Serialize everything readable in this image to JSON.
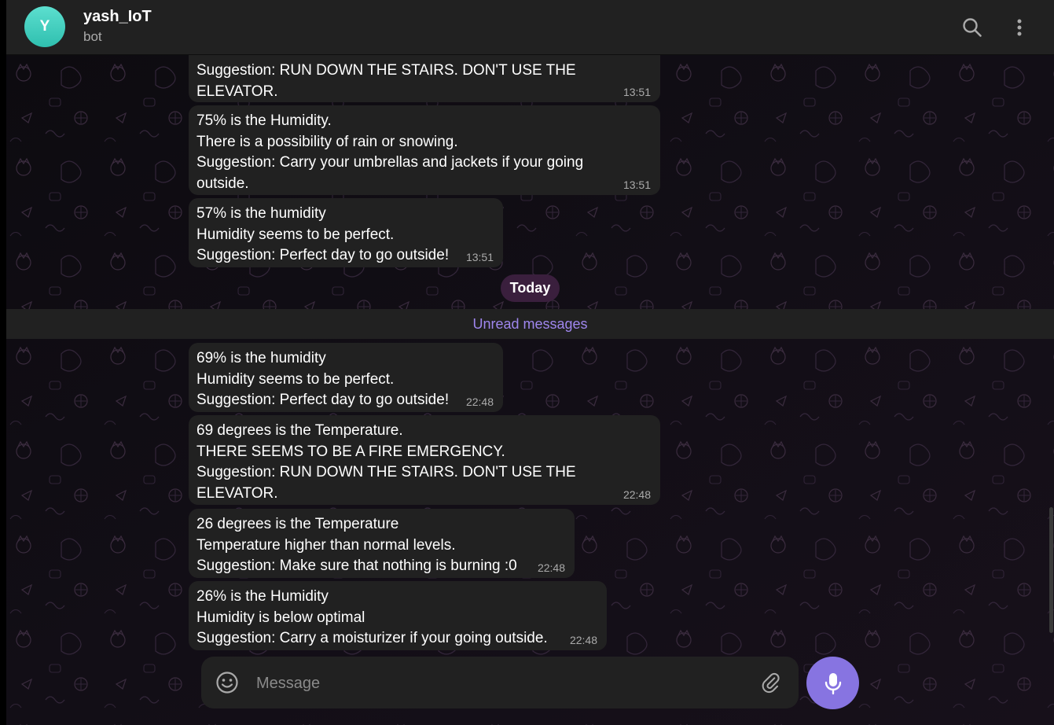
{
  "header": {
    "avatar_letter": "Y",
    "title": "yash_IoT",
    "status": "bot",
    "icons": [
      "search-icon",
      "more-vertical-icon"
    ]
  },
  "colors": {
    "accent": "#8774e1",
    "bubble": "#212121",
    "avatar": "#3fcfbf",
    "unread_text": "#9f86ee",
    "date_pill": "#3a1f3d"
  },
  "date_separator": "Today",
  "unread_label": "Unread messages",
  "messages_before": [
    {
      "lines": [
        "Suggestion: RUN DOWN THE STAIRS. DON'T USE THE",
        "ELEVATOR."
      ],
      "time": "13:51"
    },
    {
      "lines": [
        "75% is the Humidity.",
        "There is a possibility of rain or snowing.",
        "Suggestion: Carry your umbrellas and jackets if your going",
        "outside."
      ],
      "time": "13:51"
    },
    {
      "lines": [
        "57% is the humidity",
        "Humidity seems to be perfect.",
        "Suggestion: Perfect day to go outside!"
      ],
      "time": "13:51"
    }
  ],
  "messages_after": [
    {
      "lines": [
        "69% is the humidity",
        "Humidity seems to be perfect.",
        "Suggestion: Perfect day to go outside!"
      ],
      "time": "22:48"
    },
    {
      "lines": [
        "69 degrees is the Temperature.",
        "THERE SEEMS TO BE A FIRE EMERGENCY.",
        "Suggestion: RUN DOWN THE STAIRS. DON'T USE THE",
        "ELEVATOR."
      ],
      "time": "22:48"
    },
    {
      "lines": [
        "26 degrees is the Temperature",
        "Temperature higher than normal levels.",
        "Suggestion: Make sure that nothing is burning :0"
      ],
      "time": "22:48"
    },
    {
      "lines": [
        "26% is the Humidity",
        "Humidity is below optimal",
        "Suggestion: Carry a moisturizer if your going outside."
      ],
      "time": "22:48"
    }
  ],
  "composer": {
    "placeholder": "Message",
    "icons": [
      "emoji-icon",
      "paperclip-icon",
      "microphone-icon"
    ]
  }
}
